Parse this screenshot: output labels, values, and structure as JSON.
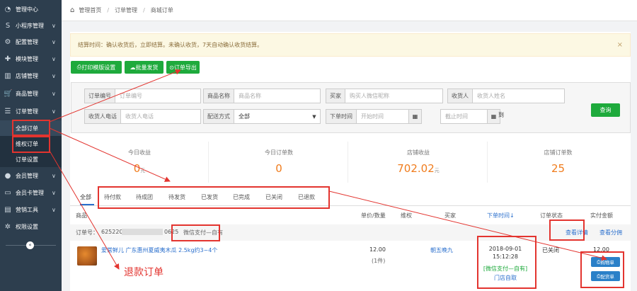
{
  "sidebar": {
    "items": [
      {
        "icon": "dashboard-icon",
        "glyph": "◔",
        "label": "管理中心",
        "chevron": ""
      },
      {
        "icon": "mini-program-icon",
        "glyph": "S",
        "label": "小程序管理",
        "chevron": "∨"
      },
      {
        "icon": "cogs-icon",
        "glyph": "⚙",
        "label": "配置管理",
        "chevron": "∨"
      },
      {
        "icon": "puzzle-icon",
        "glyph": "✚",
        "label": "模块管理",
        "chevron": "∨"
      },
      {
        "icon": "bank-icon",
        "glyph": "▥",
        "label": "店铺管理",
        "chevron": "∨"
      },
      {
        "icon": "cart-icon",
        "glyph": "🛒",
        "label": "商品管理",
        "chevron": "∨"
      },
      {
        "icon": "list-icon",
        "glyph": "☰",
        "label": "订单管理",
        "chevron": "∨"
      }
    ],
    "subitems": [
      "全部订单",
      "维权订单",
      "订单设置"
    ],
    "items2": [
      {
        "icon": "user-icon",
        "glyph": "●",
        "label": "会员管理",
        "chevron": "∨"
      },
      {
        "icon": "id-card-icon",
        "glyph": "▭",
        "label": "会员卡管理",
        "chevron": "∨"
      },
      {
        "icon": "briefcase-icon",
        "glyph": "▤",
        "label": "营销工具",
        "chevron": "∨"
      },
      {
        "icon": "gear-icon",
        "glyph": "✲",
        "label": "权限设置",
        "chevron": ""
      }
    ],
    "collapse_glyph": "«"
  },
  "breadcrumb": {
    "home": "管理首页",
    "level2": "订单管理",
    "level3": "商城订单",
    "sep": "/"
  },
  "notice": {
    "text": "结算时间：确认收货后，立即结算。未确认收货，7天自动确认收货结算。",
    "close": "×"
  },
  "toolbar": {
    "print_template": "打印模版设置",
    "batch_ship": "批量发货",
    "export": "订单导出"
  },
  "filter": {
    "order_no": {
      "label": "订单编号",
      "placeholder": "订单编号"
    },
    "product_name": {
      "label": "商品名称",
      "placeholder": "商品名称"
    },
    "buyer": {
      "label": "买家",
      "placeholder": "购买人微信昵称"
    },
    "recipient": {
      "label": "收货人",
      "placeholder": "收货人姓名"
    },
    "phone": {
      "label": "收货人电话",
      "placeholder": "收货人电话"
    },
    "delivery": {
      "label": "配送方式",
      "value": "全部"
    },
    "order_time": {
      "label": "下单时间",
      "start": "开始时间",
      "end": "截止时间",
      "to": "到"
    },
    "query_label": "查询"
  },
  "stats": [
    {
      "label": "今日收益",
      "value": "0",
      "unit": "元"
    },
    {
      "label": "今日订单数",
      "value": "0",
      "unit": ""
    },
    {
      "label": "店铺收益",
      "value": "702.02",
      "unit": "元"
    },
    {
      "label": "店铺订单数",
      "value": "25",
      "unit": ""
    }
  ],
  "tabs": [
    "全部",
    "待付款",
    "待成团",
    "待发货",
    "已发货",
    "已完成",
    "已关闭",
    "已退款"
  ],
  "table_headers": {
    "product": "商品",
    "price_qty": "单价/数量",
    "rights": "维权",
    "buyer": "买家",
    "order_time": "下单时间↓",
    "status": "订单状态",
    "amount": "实付金额"
  },
  "order": {
    "no_label": "订单号：",
    "no_prefix": "625220",
    "no_suffix": "0625",
    "pay_badge": "微信支付—自有",
    "view_detail": "查看详情",
    "view_split": "查看分佣",
    "product_name": "爱常鲜儿 广东惠州夏威夷木瓜 2.5kg约3~4个",
    "price": "12.00",
    "qty": "(1件)",
    "buyer": "朝五晚九",
    "date": "2018-09-01",
    "time": "15:12:28",
    "pay_method": "[微信支付—自有]",
    "pickup": "门店自取",
    "status": "已关闭",
    "amount": "12.00",
    "btn_shopping": "购物单",
    "btn_delivery": "配货单"
  },
  "annotation": {
    "refund_label": "退款订单",
    "color": "#e3342f"
  }
}
